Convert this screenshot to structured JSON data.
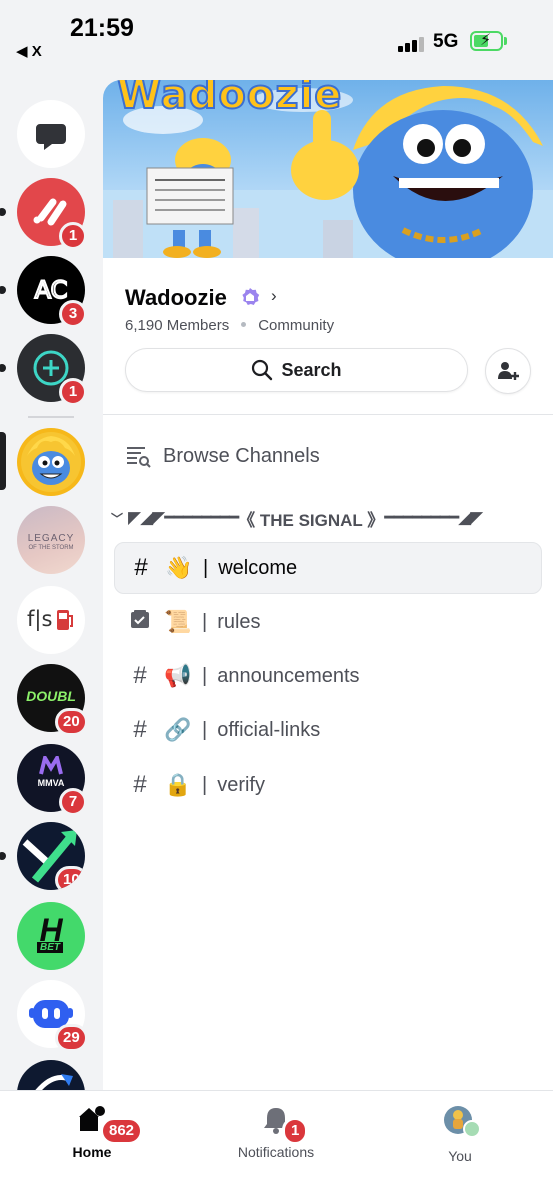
{
  "status": {
    "time": "21:59",
    "back_app": "X",
    "network": "5G"
  },
  "rail": {
    "servers": [
      {
        "name": "direct-messages",
        "badge": ""
      },
      {
        "name": "red-server",
        "badge": "1"
      },
      {
        "name": "ac-server",
        "badge": "3"
      },
      {
        "name": "plus-server",
        "badge": "1"
      },
      {
        "name": "wadoozie-server",
        "badge": ""
      },
      {
        "name": "legacy-server",
        "badge": "",
        "text": "LEGACY",
        "subtext": "OF THE STORM"
      },
      {
        "name": "fls-server",
        "badge": "",
        "text": "f|s"
      },
      {
        "name": "doubl-server",
        "badge": "20",
        "text": "DOUBL"
      },
      {
        "name": "mmva-server",
        "badge": "7",
        "text": "MMVA"
      },
      {
        "name": "arrow-server",
        "badge": "10"
      },
      {
        "name": "hbet-server",
        "badge": "",
        "text": "H",
        "subtext": "BET"
      },
      {
        "name": "robot-server",
        "badge": "29"
      }
    ]
  },
  "server": {
    "banner_title": "Wadoozie",
    "name": "Wadoozie",
    "members": "6,190 Members",
    "type": "Community",
    "search_label": "Search",
    "browse_label": "Browse Channels",
    "category_label": "《 THE SIGNAL 》",
    "category_left": "◤◢◤━━━━━━━━",
    "category_right": "━━━━━━━━◢◤"
  },
  "channels": [
    {
      "icon": "#",
      "emoji": "👋",
      "name": "welcome",
      "selected": true
    },
    {
      "icon": "rules",
      "emoji": "📜",
      "name": "rules",
      "selected": false
    },
    {
      "icon": "#",
      "emoji": "📢",
      "name": "announcements",
      "selected": false
    },
    {
      "icon": "#",
      "emoji": "🔗",
      "name": "official-links",
      "selected": false
    },
    {
      "icon": "#",
      "emoji": "🔒",
      "name": "verify",
      "selected": false
    }
  ],
  "tabbar": {
    "home_label": "Home",
    "home_badge": "862",
    "notifications_label": "Notifications",
    "notifications_badge": "1",
    "you_label": "You"
  },
  "colors": {
    "badge_red": "#da373c",
    "accent_green": "#4cd964",
    "verified_purple": "#9b84ee"
  }
}
